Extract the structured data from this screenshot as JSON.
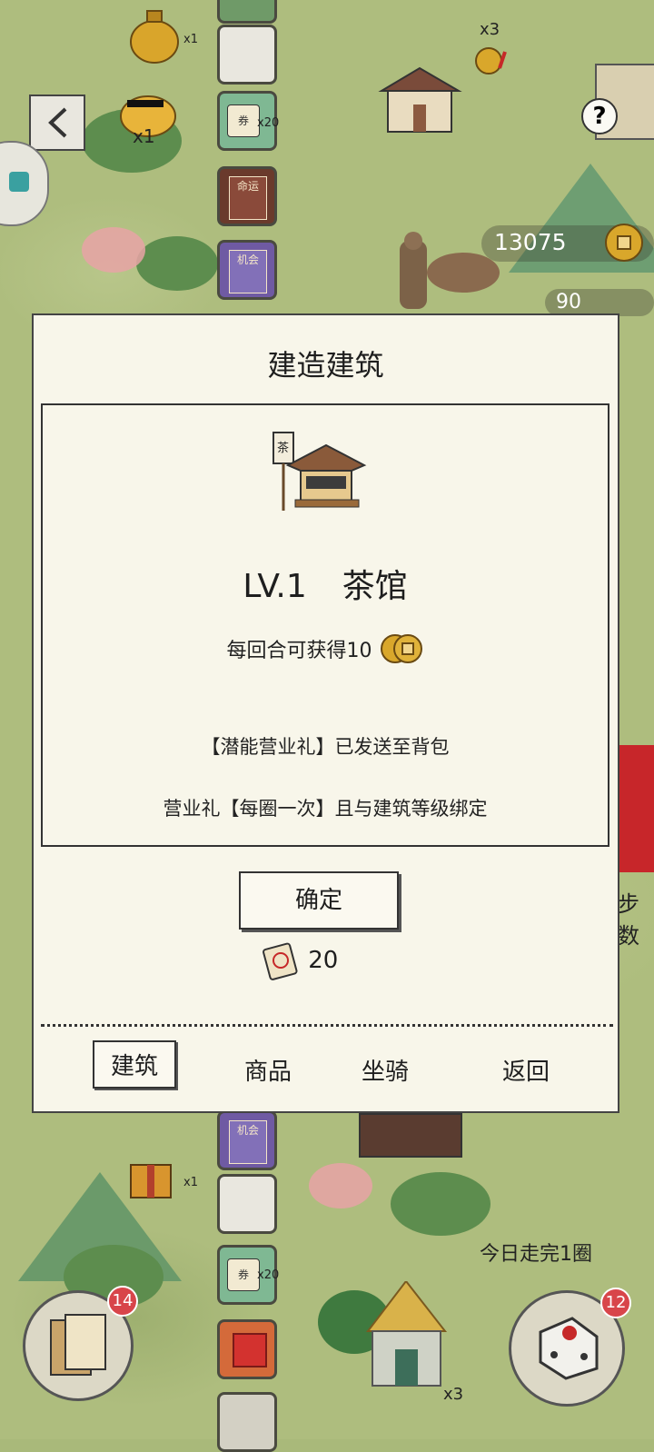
{
  "hud": {
    "coins": "13075",
    "partial_count": "90",
    "steps_partial": "步数",
    "daily_lap": "今日走完1圈",
    "cards_badge": "14",
    "dice_badge": "12",
    "jar_count": "x1",
    "pig_count": "x1",
    "coin_bonus_count": "x3",
    "ticket_tile_count_top": "x20",
    "gift_count": "x1",
    "ticket_tile_count_bottom": "x20",
    "bottom_bonus_count": "x3"
  },
  "tiles": {
    "fate_label": "命运",
    "chance_label": "机会",
    "ticket_label": "券"
  },
  "dialog": {
    "title": "建造建筑",
    "building_level": "LV.1",
    "building_name": "茶馆",
    "income_text": "每回合可获得10",
    "notice_gift": "【潜能营业礼】已发送至背包",
    "notice_bind": "营业礼【每圈一次】且与建筑等级绑定",
    "confirm_label": "确定",
    "cost_value": "20",
    "sign_text": "茶",
    "tabs": [
      {
        "label": "建筑",
        "active": true
      },
      {
        "label": "商品",
        "active": false
      },
      {
        "label": "坐骑",
        "active": false
      },
      {
        "label": "返回",
        "active": false
      }
    ]
  },
  "colors": {
    "panel_bg": "#f8f6ea",
    "border": "#333333",
    "coin": "#d9a72b",
    "badge": "#d8454a"
  },
  "icons": [
    "back-icon",
    "help-icon",
    "coin-icon",
    "ticket-icon",
    "dice-icon",
    "cards-icon",
    "gift-icon",
    "teahouse-icon"
  ]
}
